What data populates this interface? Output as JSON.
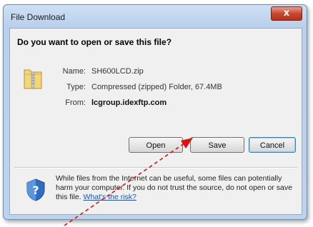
{
  "window": {
    "title": "File Download",
    "close_label": "x"
  },
  "dialog": {
    "question": "Do you want to open or save this file?",
    "name_label": "Name:",
    "name_value": "SH600LCD.zip",
    "type_label": "Type:",
    "type_value": "Compressed (zipped) Folder, 67.4MB",
    "from_label": "From:",
    "from_value": "lcgroup.idexftp.com",
    "open_label": "Open",
    "save_label": "Save",
    "cancel_label": "Cancel",
    "warning_text": "While files from the Internet can be useful, some files can potentially harm your computer. If you do not trust the source, do not open or save this file.",
    "risk_link": "What's the risk?"
  },
  "icons": {
    "folder": "zip-folder-icon",
    "shield": "security-shield-icon",
    "arrow": "red-arrow-annotation"
  },
  "colors": {
    "arrow": "#e01010",
    "close": "#c9472f",
    "link": "#0b57c2"
  }
}
